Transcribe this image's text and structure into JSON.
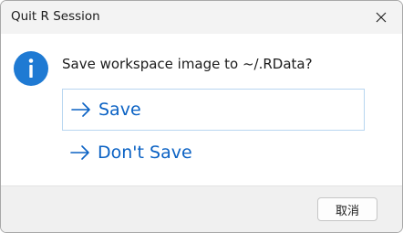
{
  "window": {
    "title": "Quit R Session",
    "close_icon": "close-icon"
  },
  "dialog": {
    "icon": "info-icon",
    "message": "Save workspace image to ~/.RData?",
    "options": [
      {
        "label": "Save",
        "icon": "arrow-right-icon",
        "focused": true
      },
      {
        "label": "Don't Save",
        "icon": "arrow-right-icon",
        "focused": false
      }
    ]
  },
  "footer": {
    "cancel_label": "取消"
  },
  "colors": {
    "accent": "#0b62c4",
    "info_icon": "#1f7ad3",
    "titlebar": "#f3f3f3",
    "footer": "#f0f0f0"
  }
}
